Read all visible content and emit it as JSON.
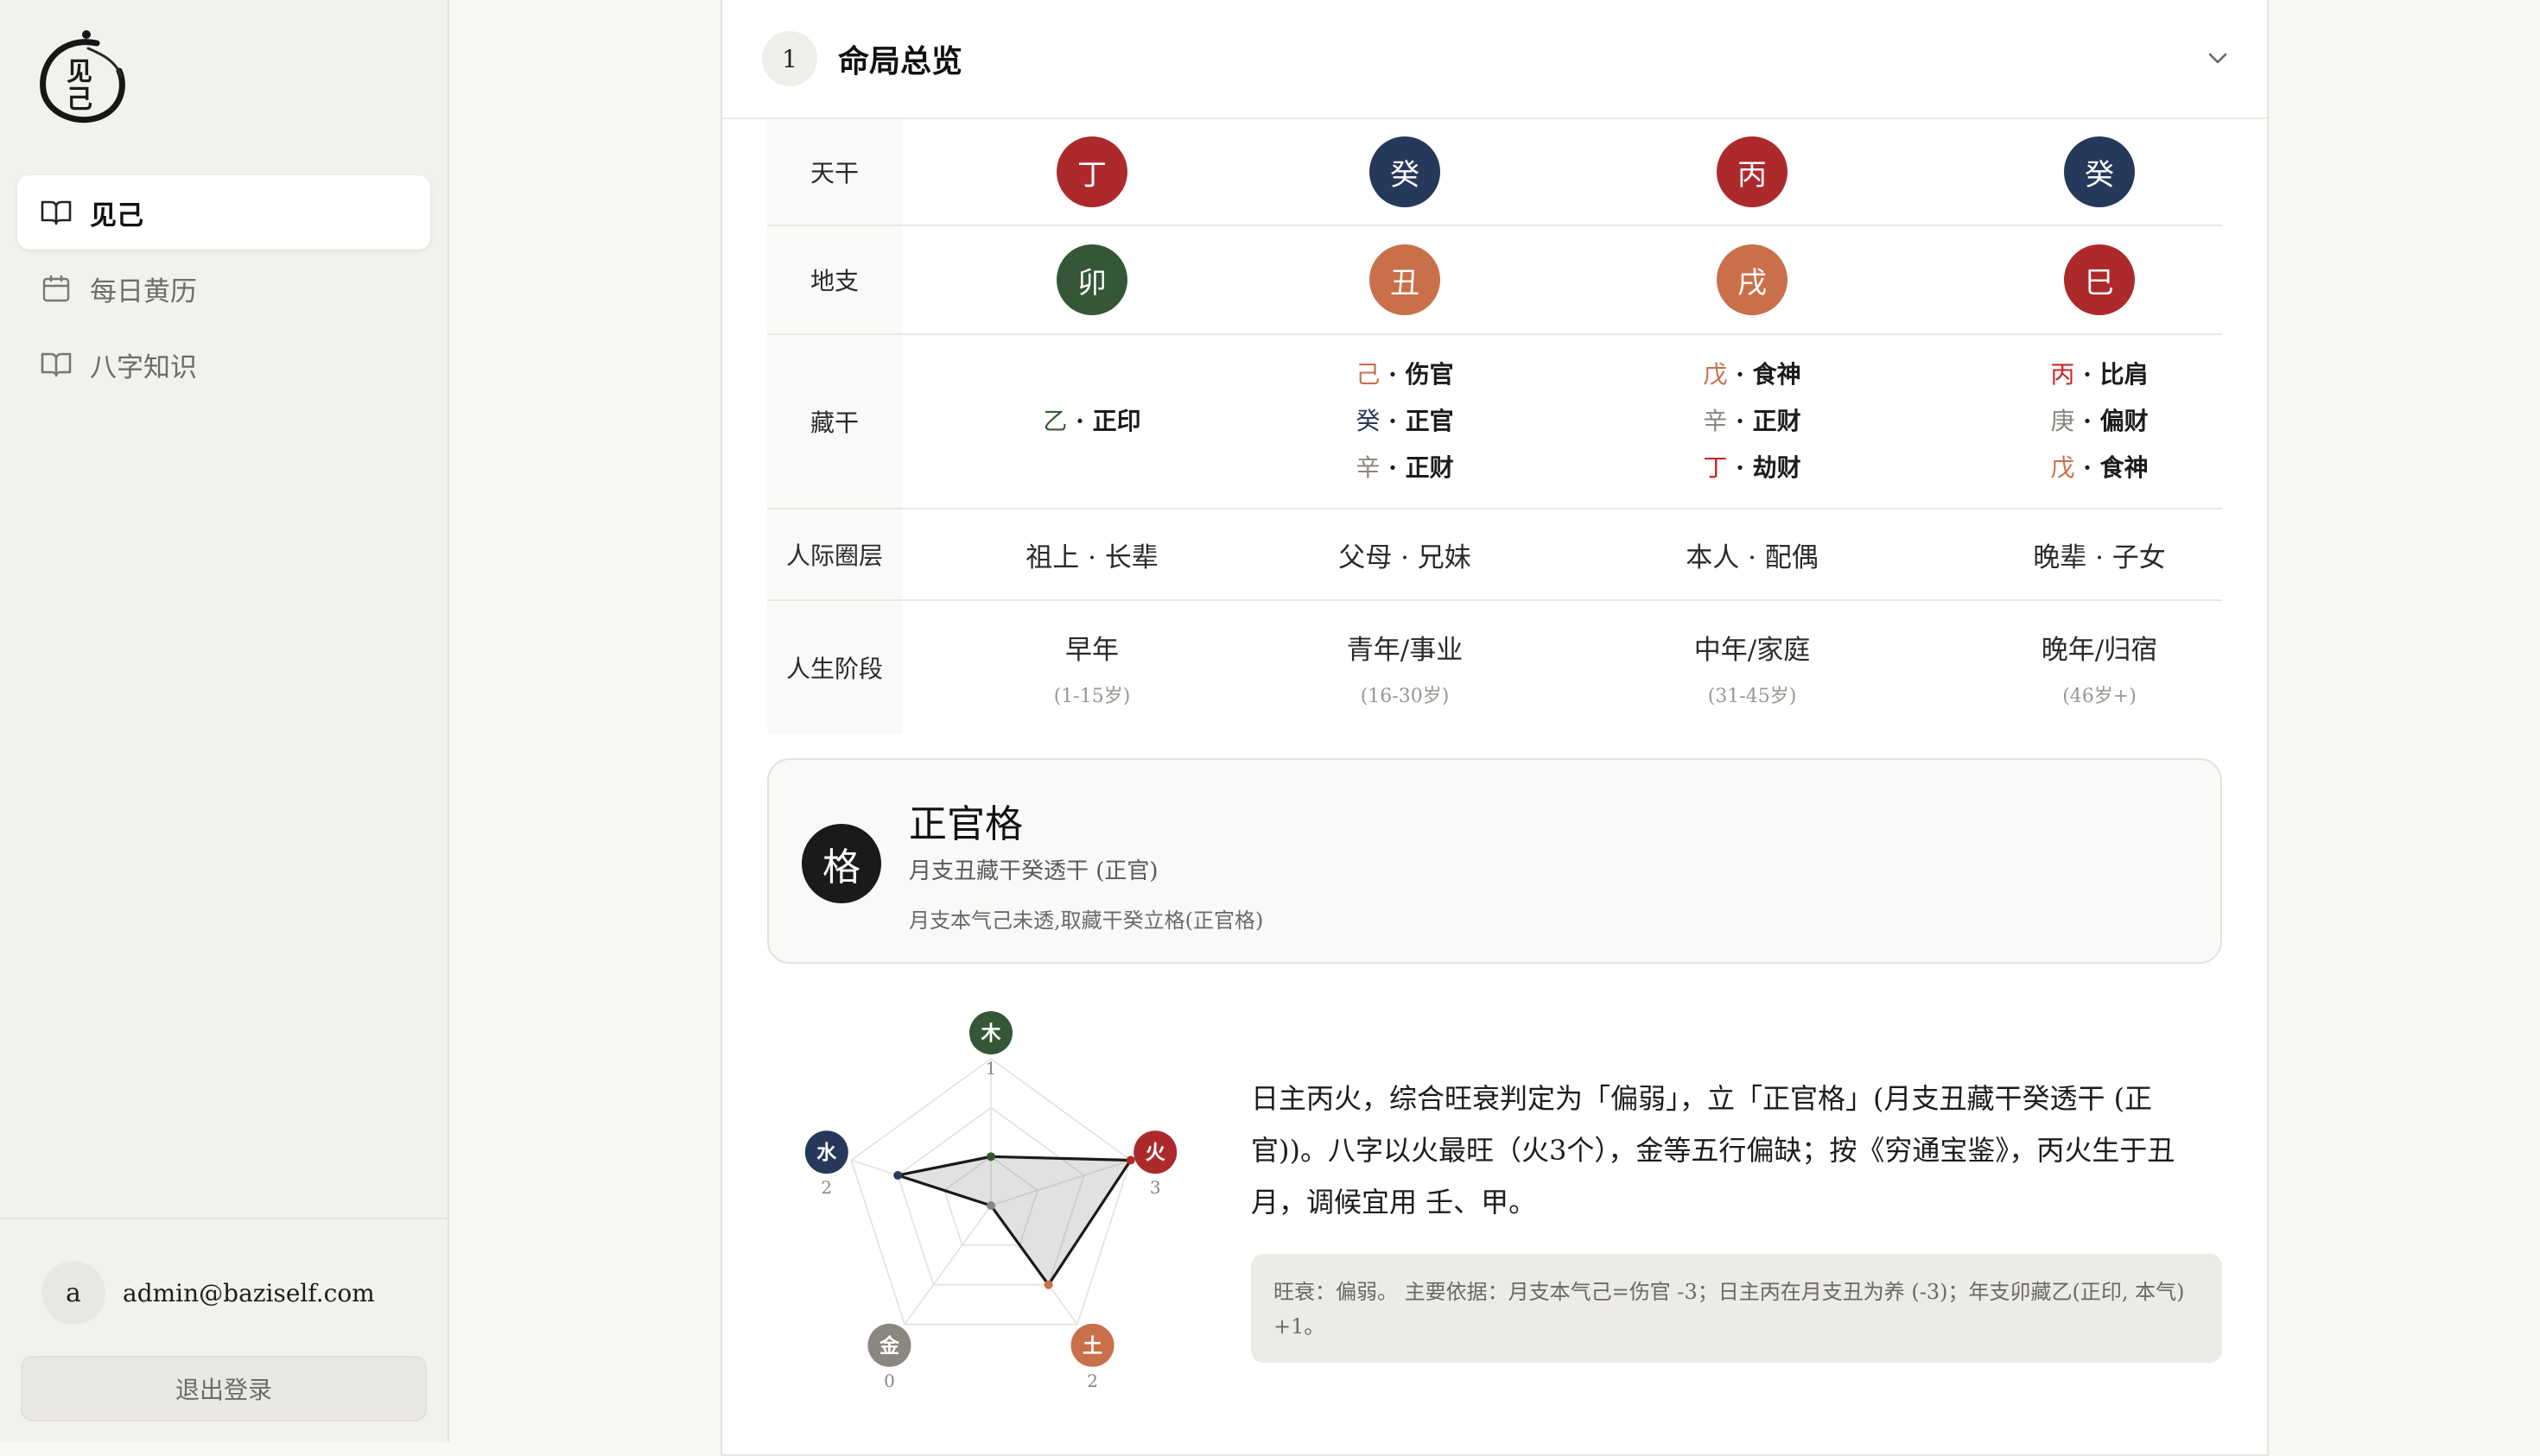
{
  "app": {
    "logo_text": "见\n己"
  },
  "sidebar": {
    "items": [
      {
        "label": "见己",
        "icon": "book-open-icon",
        "active": true
      },
      {
        "label": "每日黄历",
        "icon": "calendar-icon",
        "active": false
      },
      {
        "label": "八字知识",
        "icon": "book-open-icon",
        "active": false
      }
    ],
    "user": {
      "avatar": "a",
      "email": "admin@baziself.com"
    },
    "logout_label": "退出登录"
  },
  "section": {
    "number": "1",
    "title": "命局总览"
  },
  "pillars": {
    "row_labels": {
      "tiangan": "天干",
      "dizhi": "地支",
      "canggan": "藏干",
      "relation": "人际圈层",
      "stage": "人生阶段"
    },
    "tiangan": [
      {
        "char": "丁",
        "color": "#ad2a2c"
      },
      {
        "char": "癸",
        "color": "#27395a"
      },
      {
        "char": "丙",
        "color": "#ad2a2c"
      },
      {
        "char": "癸",
        "color": "#27395a"
      }
    ],
    "dizhi": [
      {
        "char": "卯",
        "color": "#355737"
      },
      {
        "char": "丑",
        "color": "#c9704a"
      },
      {
        "char": "戌",
        "color": "#c9704a"
      },
      {
        "char": "巳",
        "color": "#ad2a2c"
      }
    ],
    "canggan": [
      [
        {
          "stem": "乙",
          "stem_color": "#355737",
          "god": "正印"
        }
      ],
      [
        {
          "stem": "己",
          "stem_color": "#c9704a",
          "god": "伤官"
        },
        {
          "stem": "癸",
          "stem_color": "#27395a",
          "god": "正官"
        },
        {
          "stem": "辛",
          "stem_color": "#8a8680",
          "god": "正财"
        }
      ],
      [
        {
          "stem": "戊",
          "stem_color": "#c9704a",
          "god": "食神"
        },
        {
          "stem": "辛",
          "stem_color": "#8a8680",
          "god": "正财"
        },
        {
          "stem": "丁",
          "stem_color": "#c62828",
          "god": "劫财"
        }
      ],
      [
        {
          "stem": "丙",
          "stem_color": "#c62828",
          "god": "比肩"
        },
        {
          "stem": "庚",
          "stem_color": "#8a8680",
          "god": "偏财"
        },
        {
          "stem": "戊",
          "stem_color": "#c9704a",
          "god": "食神"
        }
      ]
    ],
    "separator": " · ",
    "relation": [
      "祖上 · 长辈",
      "父母 · 兄妹",
      "本人 · 配偶",
      "晚辈 · 子女"
    ],
    "stage": [
      {
        "name": "早年",
        "age": "(1-15岁)"
      },
      {
        "name": "青年/事业",
        "age": "(16-30岁)"
      },
      {
        "name": "中年/家庭",
        "age": "(31-45岁)"
      },
      {
        "name": "晚年/归宿",
        "age": "(46岁+)"
      }
    ]
  },
  "geju": {
    "icon_char": "格",
    "name": "正官格",
    "subtitle": "月支丑藏干癸透干 (正官)",
    "note": "月支本气己未透,取藏干癸立格(正官格)"
  },
  "wuxing": {
    "elements": [
      {
        "name": "木",
        "value": "1",
        "color": "#355737"
      },
      {
        "name": "火",
        "value": "3",
        "color": "#ad2a2c"
      },
      {
        "name": "土",
        "value": "2",
        "color": "#c9704a"
      },
      {
        "name": "金",
        "value": "0",
        "color": "#8a8680"
      },
      {
        "name": "水",
        "value": "2",
        "color": "#27395a"
      }
    ],
    "max": 3
  },
  "analysis": {
    "text": "日主丙火，综合旺衰判定为「偏弱」，立「正官格」(月支丑藏干癸透干 (正官))。八字以火最旺（火3个），金等五行偏缺；按《穷通宝鉴》，丙火生于丑月，调候宜用 壬、甲。",
    "note": "旺衰：偏弱。 主要依据：月支本气己=伤官 -3；日主丙在月支丑为养 (-3)；年支卯藏乙(正印, 本气) +1。"
  }
}
